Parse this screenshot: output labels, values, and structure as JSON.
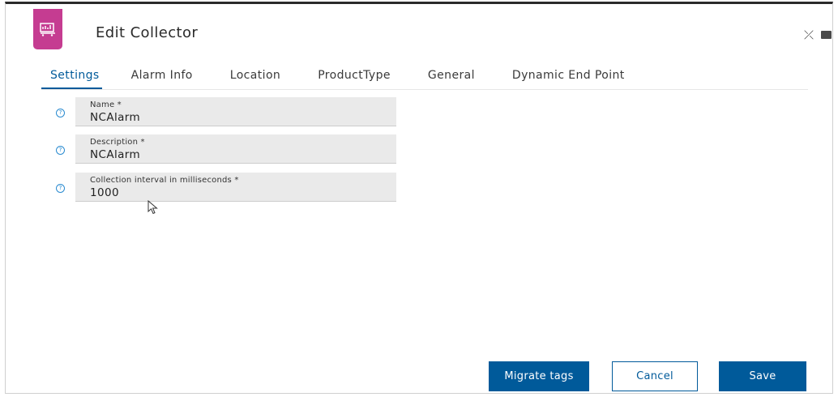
{
  "dialog": {
    "title": "Edit Collector",
    "app_icon": "collector-icon",
    "close_symbol": "⤫",
    "accent_color": "#c53c91",
    "primary_color": "#005a9a"
  },
  "tabs": [
    {
      "label": "Settings",
      "active": true
    },
    {
      "label": "Alarm Info",
      "active": false
    },
    {
      "label": "Location",
      "active": false
    },
    {
      "label": "ProductType",
      "active": false
    },
    {
      "label": "General",
      "active": false
    },
    {
      "label": "Dynamic End Point",
      "active": false
    }
  ],
  "fields": {
    "name": {
      "label": "Name *",
      "value": "NCAlarm"
    },
    "description": {
      "label": "Description *",
      "value": "NCAlarm"
    },
    "interval": {
      "label": "Collection interval in milliseconds *",
      "value": "1000"
    }
  },
  "help_glyph": "?",
  "buttons": {
    "migrate": "Migrate tags",
    "cancel": "Cancel",
    "save": "Save"
  }
}
